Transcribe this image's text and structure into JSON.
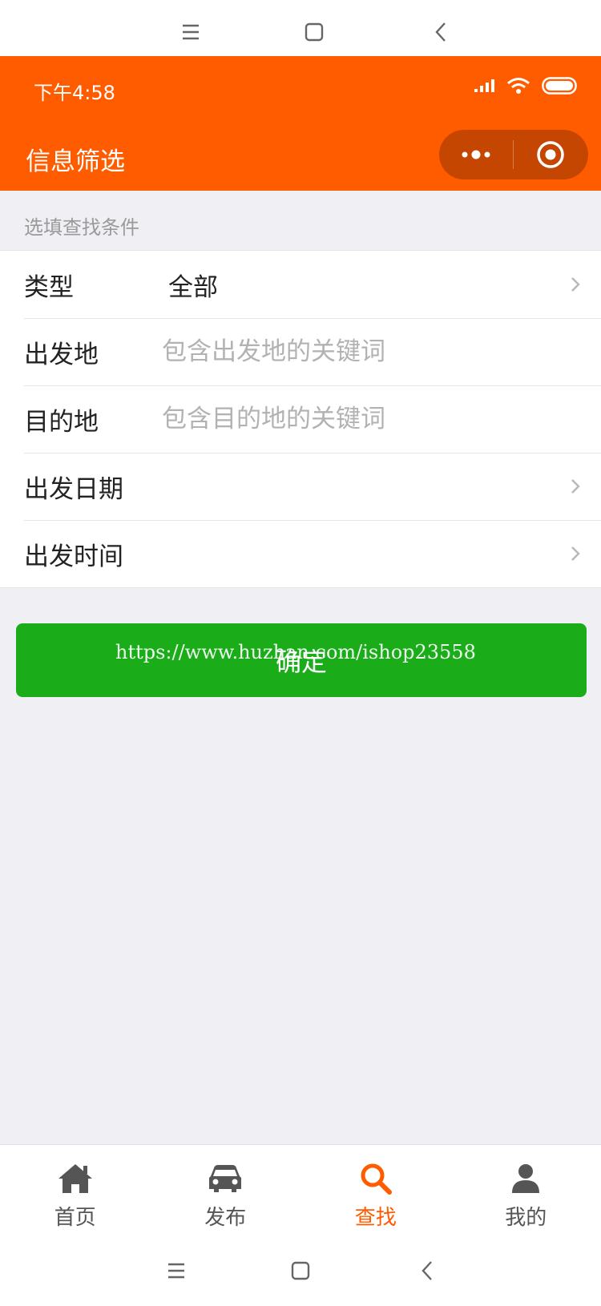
{
  "status_bar": {
    "time": "下午4:58"
  },
  "header": {
    "title": "信息筛选"
  },
  "capsule": {
    "more_icon": "more-dots-icon",
    "close_icon": "target-circle-icon"
  },
  "form": {
    "section_hint": "选填查找条件",
    "type": {
      "label": "类型",
      "value": "全部"
    },
    "origin": {
      "label": "出发地",
      "placeholder": "包含出发地的关键词"
    },
    "destination": {
      "label": "目的地",
      "placeholder": "包含目的地的关键词"
    },
    "date": {
      "label": "出发日期"
    },
    "time": {
      "label": "出发时间"
    }
  },
  "confirm": {
    "label": "确定"
  },
  "watermark": "https://www.huzhan.com/ishop23558",
  "tabbar": {
    "items": [
      {
        "label": "首页",
        "icon": "home-icon"
      },
      {
        "label": "发布",
        "icon": "car-icon"
      },
      {
        "label": "查找",
        "icon": "search-icon"
      },
      {
        "label": "我的",
        "icon": "user-icon"
      }
    ],
    "active_index": 2
  },
  "colors": {
    "brand": "#ff5c00",
    "confirm": "#1aad19",
    "background": "#efeff4"
  }
}
